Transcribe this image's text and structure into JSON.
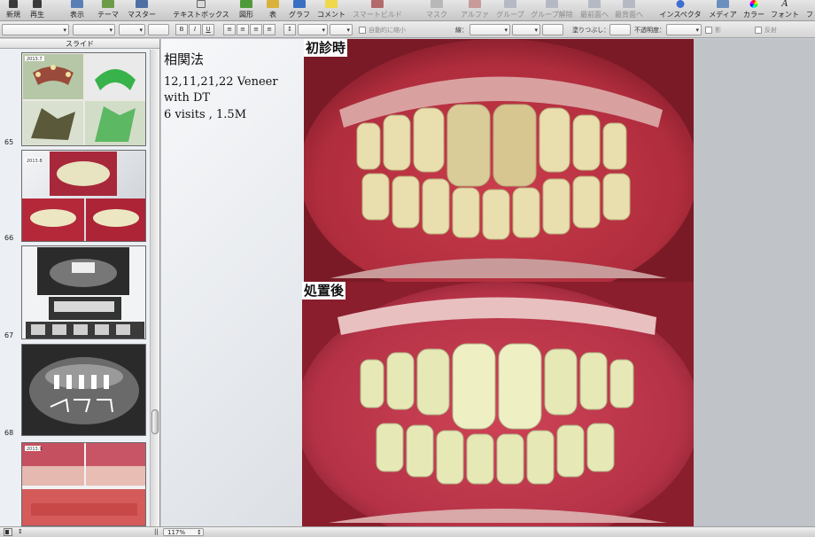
{
  "toolbar": {
    "items": [
      {
        "label": "新規",
        "icon": "new-document-icon"
      },
      {
        "label": "再生",
        "icon": "play-icon"
      },
      {
        "label": "表示",
        "icon": "view-icon"
      },
      {
        "label": "テーマ",
        "icon": "theme-icon"
      },
      {
        "label": "マスター",
        "icon": "master-icon"
      },
      {
        "label": "テキストボックス",
        "icon": "text-box-icon"
      },
      {
        "label": "図形",
        "icon": "shapes-icon"
      },
      {
        "label": "表",
        "icon": "table-icon"
      },
      {
        "label": "グラフ",
        "icon": "chart-icon"
      },
      {
        "label": "コメント",
        "icon": "comment-icon"
      },
      {
        "label": "スマートビルド",
        "icon": "smart-build-icon"
      },
      {
        "label": "マスク",
        "icon": "mask-icon"
      },
      {
        "label": "アルファ",
        "icon": "alpha-icon"
      },
      {
        "label": "グループ",
        "icon": "group-icon"
      },
      {
        "label": "グループ解除",
        "icon": "ungroup-icon"
      },
      {
        "label": "最前面へ",
        "icon": "bring-to-front-icon"
      },
      {
        "label": "最背面へ",
        "icon": "send-to-back-icon"
      },
      {
        "label": "インスペクタ",
        "icon": "inspector-icon"
      },
      {
        "label": "メディア",
        "icon": "media-icon"
      },
      {
        "label": "カラー",
        "icon": "colors-icon"
      },
      {
        "label": "フォント",
        "icon": "fonts-icon"
      },
      {
        "label": "フ",
        "icon": "more-icon"
      }
    ]
  },
  "formatbar": {
    "bold": "B",
    "italic": "I",
    "underline": "U",
    "autoshrink": "自動的に縮小",
    "line": "線：",
    "fill": "塗りつぶし：",
    "opacity": "不透明度：",
    "shadow": "影",
    "reflection": "反射"
  },
  "sidebar": {
    "header": "スライド",
    "slides": [
      {
        "number": "65",
        "date": "2013.7"
      },
      {
        "number": "66",
        "date": "2013.8"
      },
      {
        "number": "67",
        "date": ""
      },
      {
        "number": "68",
        "date": ""
      },
      {
        "number": "",
        "date": "2013.9"
      }
    ]
  },
  "slide": {
    "title": "相関法",
    "body": [
      "12,11,21,22 Veneer",
      "with DT",
      "6 visits , 1.5M"
    ],
    "before_caption": "初診時",
    "after_caption": "処置後"
  },
  "statusbar": {
    "zoom": "117%"
  },
  "colors": {
    "gum": "#c8384a",
    "lip": "#8c1d2a",
    "tooth": "#e8e3b8"
  }
}
